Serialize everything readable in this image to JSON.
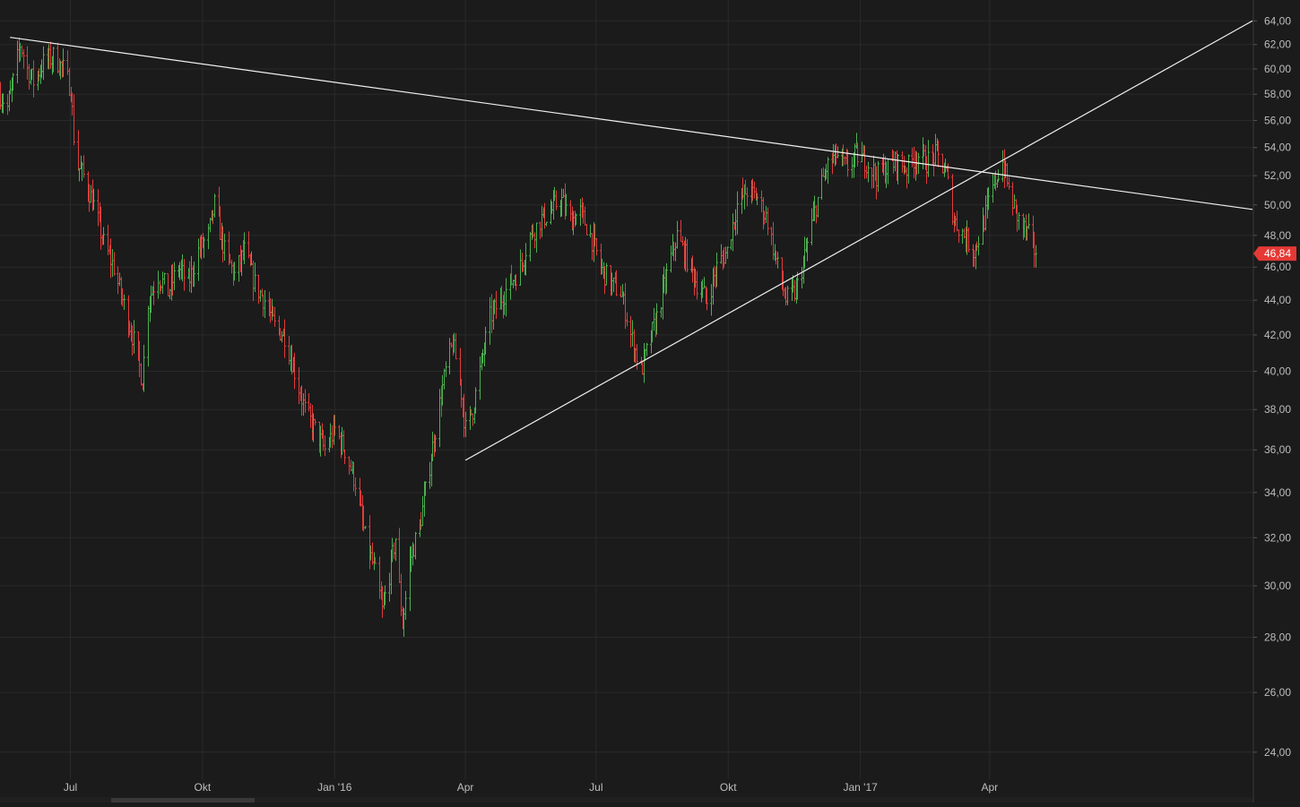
{
  "chart_data": {
    "type": "ohlc",
    "title": "",
    "xlabel": "",
    "ylabel": "",
    "y_scale": "log",
    "ylim": [
      23.2,
      65.5
    ],
    "xlim": [
      "2015-05-13",
      "2017-10-01"
    ],
    "grid": true,
    "colors": {
      "background": "#1b1b1b",
      "grid": "#2a2a2a",
      "up": "#4caf50",
      "down": "#e03c3c",
      "trendline": "#f0f0f0",
      "axis_text": "#bdbdbd",
      "last_price_badge": "#e53935"
    },
    "y_ticks": [
      {
        "value": 24,
        "label": "24,00"
      },
      {
        "value": 26,
        "label": "26,00"
      },
      {
        "value": 28,
        "label": "28,00"
      },
      {
        "value": 30,
        "label": "30,00"
      },
      {
        "value": 32,
        "label": "32,00"
      },
      {
        "value": 34,
        "label": "34,00"
      },
      {
        "value": 36,
        "label": "36,00"
      },
      {
        "value": 38,
        "label": "38,00"
      },
      {
        "value": 40,
        "label": "40,00"
      },
      {
        "value": 42,
        "label": "42,00"
      },
      {
        "value": 44,
        "label": "44,00"
      },
      {
        "value": 46,
        "label": "46,00"
      },
      {
        "value": 48,
        "label": "48,00"
      },
      {
        "value": 50,
        "label": "50,00"
      },
      {
        "value": 52,
        "label": "52,00"
      },
      {
        "value": 54,
        "label": "54,00"
      },
      {
        "value": 56,
        "label": "56,00"
      },
      {
        "value": 58,
        "label": "58,00"
      },
      {
        "value": 60,
        "label": "60,00"
      },
      {
        "value": 62,
        "label": "62,00"
      },
      {
        "value": 64,
        "label": "64,00"
      }
    ],
    "x_ticks": [
      {
        "date": "2015-07-01",
        "label": "Jul"
      },
      {
        "date": "2015-10-01",
        "label": "Okt"
      },
      {
        "date": "2016-01-01",
        "label": "Jan '16"
      },
      {
        "date": "2016-04-01",
        "label": "Apr"
      },
      {
        "date": "2016-07-01",
        "label": "Jul"
      },
      {
        "date": "2016-10-01",
        "label": "Okt"
      },
      {
        "date": "2017-01-01",
        "label": "Jan '17"
      },
      {
        "date": "2017-04-01",
        "label": "Apr"
      }
    ],
    "last_price": {
      "value": 46.84,
      "label": "46,84"
    },
    "price_path": [
      [
        "2015-05-13",
        58.0
      ],
      [
        "2015-05-18",
        57.0
      ],
      [
        "2015-05-22",
        59.0
      ],
      [
        "2015-05-27",
        62.0
      ],
      [
        "2015-06-01",
        60.0
      ],
      [
        "2015-06-05",
        59.0
      ],
      [
        "2015-06-12",
        60.5
      ],
      [
        "2015-06-19",
        61.0
      ],
      [
        "2015-06-26",
        60.0
      ],
      [
        "2015-07-01",
        58.5
      ],
      [
        "2015-07-04",
        53.0
      ],
      [
        "2015-07-10",
        52.0
      ],
      [
        "2015-07-17",
        50.0
      ],
      [
        "2015-07-24",
        47.5
      ],
      [
        "2015-07-31",
        46.0
      ],
      [
        "2015-08-06",
        44.0
      ],
      [
        "2015-08-13",
        42.0
      ],
      [
        "2015-08-20",
        39.5
      ],
      [
        "2015-08-24",
        44.0
      ],
      [
        "2015-08-31",
        45.5
      ],
      [
        "2015-09-07",
        44.5
      ],
      [
        "2015-09-14",
        46.0
      ],
      [
        "2015-09-21",
        45.0
      ],
      [
        "2015-09-28",
        47.0
      ],
      [
        "2015-10-05",
        48.0
      ],
      [
        "2015-10-09",
        50.0
      ],
      [
        "2015-10-16",
        47.0
      ],
      [
        "2015-10-23",
        45.5
      ],
      [
        "2015-10-30",
        47.0
      ],
      [
        "2015-11-06",
        45.0
      ],
      [
        "2015-11-13",
        44.0
      ],
      [
        "2015-11-20",
        42.5
      ],
      [
        "2015-11-27",
        42.0
      ],
      [
        "2015-12-04",
        40.0
      ],
      [
        "2015-12-11",
        38.0
      ],
      [
        "2015-12-18",
        37.0
      ],
      [
        "2015-12-25",
        36.0
      ],
      [
        "2016-01-01",
        37.0
      ],
      [
        "2016-01-08",
        36.0
      ],
      [
        "2016-01-15",
        34.5
      ],
      [
        "2016-01-22",
        32.0
      ],
      [
        "2016-01-29",
        30.5
      ],
      [
        "2016-02-03",
        29.0
      ],
      [
        "2016-02-08",
        30.5
      ],
      [
        "2016-02-12",
        32.0
      ],
      [
        "2016-02-17",
        28.5
      ],
      [
        "2016-02-22",
        31.0
      ],
      [
        "2016-02-29",
        32.5
      ],
      [
        "2016-03-04",
        34.0
      ],
      [
        "2016-03-11",
        37.0
      ],
      [
        "2016-03-18",
        40.0
      ],
      [
        "2016-03-23",
        41.5
      ],
      [
        "2016-03-28",
        39.5
      ],
      [
        "2016-04-01",
        37.0
      ],
      [
        "2016-04-06",
        38.0
      ],
      [
        "2016-04-11",
        40.0
      ],
      [
        "2016-04-18",
        43.0
      ],
      [
        "2016-04-25",
        44.0
      ],
      [
        "2016-05-02",
        45.0
      ],
      [
        "2016-05-09",
        46.0
      ],
      [
        "2016-05-16",
        48.0
      ],
      [
        "2016-05-23",
        49.0
      ],
      [
        "2016-05-30",
        49.5
      ],
      [
        "2016-06-06",
        50.5
      ],
      [
        "2016-06-13",
        49.0
      ],
      [
        "2016-06-20",
        49.5
      ],
      [
        "2016-06-27",
        48.0
      ],
      [
        "2016-07-04",
        46.0
      ],
      [
        "2016-07-11",
        45.0
      ],
      [
        "2016-07-18",
        44.5
      ],
      [
        "2016-07-25",
        42.0
      ],
      [
        "2016-08-01",
        40.0
      ],
      [
        "2016-08-05",
        41.0
      ],
      [
        "2016-08-12",
        43.0
      ],
      [
        "2016-08-19",
        45.5
      ],
      [
        "2016-08-26",
        48.0
      ],
      [
        "2016-09-02",
        46.5
      ],
      [
        "2016-09-09",
        45.0
      ],
      [
        "2016-09-16",
        44.0
      ],
      [
        "2016-09-23",
        46.0
      ],
      [
        "2016-09-30",
        47.0
      ],
      [
        "2016-10-07",
        50.0
      ],
      [
        "2016-10-14",
        51.0
      ],
      [
        "2016-10-21",
        50.5
      ],
      [
        "2016-10-28",
        49.0
      ],
      [
        "2016-11-04",
        46.0
      ],
      [
        "2016-11-10",
        44.0
      ],
      [
        "2016-11-17",
        44.5
      ],
      [
        "2016-11-24",
        47.0
      ],
      [
        "2016-12-01",
        50.0
      ],
      [
        "2016-12-08",
        52.5
      ],
      [
        "2016-12-15",
        53.5
      ],
      [
        "2016-12-22",
        52.5
      ],
      [
        "2016-12-29",
        53.5
      ],
      [
        "2017-01-05",
        53.0
      ],
      [
        "2017-01-12",
        52.0
      ],
      [
        "2017-01-19",
        52.5
      ],
      [
        "2017-01-26",
        53.0
      ],
      [
        "2017-02-02",
        52.5
      ],
      [
        "2017-02-09",
        53.5
      ],
      [
        "2017-02-16",
        53.0
      ],
      [
        "2017-02-23",
        53.5
      ],
      [
        "2017-03-02",
        52.0
      ],
      [
        "2017-03-07",
        49.0
      ],
      [
        "2017-03-14",
        48.0
      ],
      [
        "2017-03-21",
        47.0
      ],
      [
        "2017-03-28",
        49.0
      ],
      [
        "2017-04-04",
        51.5
      ],
      [
        "2017-04-10",
        53.0
      ],
      [
        "2017-04-14",
        51.0
      ],
      [
        "2017-04-21",
        49.0
      ],
      [
        "2017-04-28",
        48.0
      ],
      [
        "2017-05-03",
        46.84
      ]
    ],
    "trendlines": [
      {
        "name": "resistance",
        "start": [
          "2015-05-20",
          62.6
        ],
        "end": [
          "2017-10-01",
          49.7
        ]
      },
      {
        "name": "support",
        "start": [
          "2016-04-01",
          35.5
        ],
        "end": [
          "2017-10-01",
          64.0
        ]
      }
    ]
  }
}
